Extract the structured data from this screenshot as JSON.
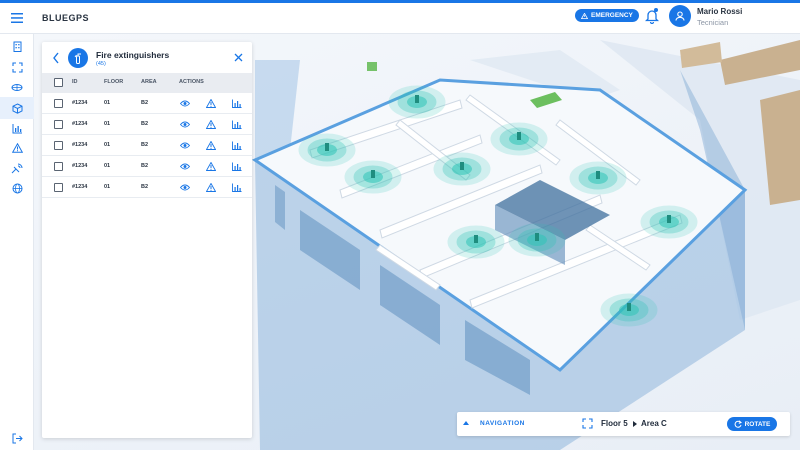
{
  "app": {
    "brand": "BLUEGPS"
  },
  "header": {
    "emergency_label": "EMERGENCY",
    "user": {
      "name": "Mario Rossi",
      "role": "Tecnician"
    }
  },
  "sidebar": {
    "items": [
      {
        "icon": "building-icon"
      },
      {
        "icon": "scan-icon"
      },
      {
        "icon": "layers-icon"
      },
      {
        "icon": "cube-icon",
        "active": true
      },
      {
        "icon": "chart-icon"
      },
      {
        "icon": "warning-icon"
      },
      {
        "icon": "satellite-icon"
      },
      {
        "icon": "globe-icon"
      }
    ],
    "logout_icon": "logout-icon"
  },
  "panel": {
    "title": "Fire extinguishers",
    "count": "(45)",
    "columns": [
      "ID",
      "FLOOR",
      "AREA",
      "ACTIONS"
    ],
    "rows": [
      {
        "id": "#1234",
        "floor": "01",
        "area": "B2"
      },
      {
        "id": "#1234",
        "floor": "01",
        "area": "B2"
      },
      {
        "id": "#1234",
        "floor": "01",
        "area": "B2"
      },
      {
        "id": "#1234",
        "floor": "01",
        "area": "B2"
      },
      {
        "id": "#1234",
        "floor": "01",
        "area": "B2"
      }
    ],
    "row_actions": [
      "eye-icon",
      "warning-icon",
      "chart-icon"
    ]
  },
  "navigation": {
    "label": "NAVIGATION",
    "floor": "Floor 5",
    "area": "Area C",
    "rotate_label": "ROTATE"
  },
  "colors": {
    "accent": "#1976e6",
    "marker": "#2ec4b6"
  }
}
